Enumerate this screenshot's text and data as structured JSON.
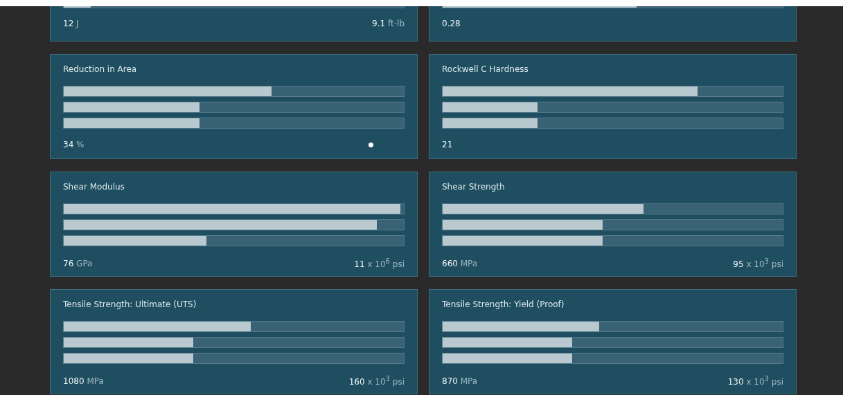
{
  "cards": [
    {
      "bars": [
        {
          "level": 0.08
        }
      ],
      "metric": {
        "value": "12",
        "unit": "J"
      },
      "imperial": {
        "value": "9.1",
        "unit": "ft-lb"
      },
      "dot": false
    },
    {
      "bars": [
        {
          "level": 0.57
        }
      ],
      "metric": {
        "value": "0.28"
      },
      "dot": false
    },
    {
      "title": "Reduction in Area",
      "bars": [
        {
          "level": 0.61
        },
        {
          "level": 0.4
        },
        {
          "level": 0.4
        }
      ],
      "metric": {
        "value": "34",
        "unit": "%"
      },
      "dot": true
    },
    {
      "title": "Rockwell C Hardness",
      "bars": [
        {
          "level": 0.75
        },
        {
          "level": 0.28
        },
        {
          "level": 0.28
        }
      ],
      "metric": {
        "value": "21"
      },
      "dot": false
    },
    {
      "title": "Shear Modulus",
      "bars": [
        {
          "level": 0.99
        },
        {
          "level": 0.92
        },
        {
          "level": 0.42
        }
      ],
      "metric": {
        "value": "76",
        "unit": "GPa"
      },
      "imperial": {
        "value": "11",
        "unit": "x 10$^{6}$ psi"
      },
      "dot": false
    },
    {
      "title": "Shear Strength",
      "bars": [
        {
          "level": 0.59
        },
        {
          "level": 0.47
        },
        {
          "level": 0.47
        }
      ],
      "metric": {
        "value": "660",
        "unit": "MPa"
      },
      "imperial": {
        "value": "95",
        "unit": "x 10$^{3}$ psi"
      },
      "dot": false
    },
    {
      "title": "Tensile Strength: Ultimate (UTS)",
      "bars": [
        {
          "level": 0.55
        },
        {
          "level": 0.38
        },
        {
          "level": 0.38
        }
      ],
      "metric": {
        "value": "1080",
        "unit": "MPa"
      },
      "imperial": {
        "value": "160",
        "unit": "x 10$^{3}$ psi"
      },
      "dot": false
    },
    {
      "title": "Tensile Strength: Yield (Proof)",
      "bars": [
        {
          "level": 0.46
        },
        {
          "level": 0.38
        },
        {
          "level": 0.38
        }
      ],
      "metric": {
        "value": "870",
        "unit": "MPa"
      },
      "imperial": {
        "value": "130",
        "unit": "x 10$^{3}$ psi"
      },
      "dot": false
    }
  ]
}
